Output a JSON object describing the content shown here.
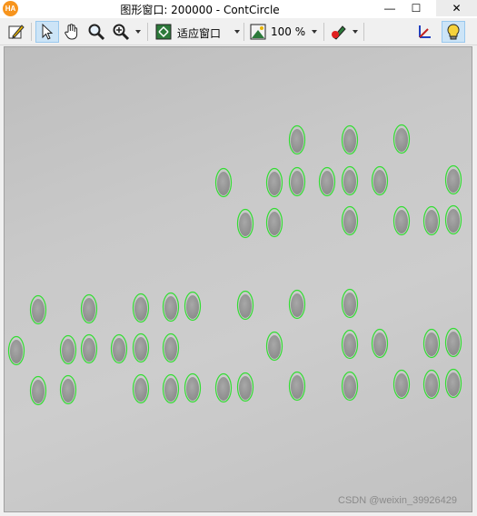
{
  "window": {
    "title": "图形窗口: 200000 - ContCircle",
    "logo_text": "HA",
    "minimize_glyph": "—",
    "maximize_glyph": "☐",
    "close_glyph": "✕"
  },
  "toolbar": {
    "items": [
      {
        "name": "edit-icon"
      },
      {
        "name": "pointer-icon",
        "active": true
      },
      {
        "name": "hand-icon"
      },
      {
        "name": "magnifier-icon"
      },
      {
        "name": "zoom-in-icon",
        "dropdown": true
      },
      {
        "name": "fit-window-icon"
      },
      {
        "name": "zoom-percent-icon"
      },
      {
        "name": "draw-color-icon",
        "dropdown": true
      },
      {
        "name": "axes-icon"
      },
      {
        "name": "light-bulb-icon",
        "active": true
      }
    ],
    "fit_label": "适应窗口",
    "zoom_value": "100 %"
  },
  "canvas": {
    "contour_color": "#33dd33",
    "marks": "contour circles drawn around the engraved dots"
  },
  "watermark": "CSDN @weixin_39926429"
}
